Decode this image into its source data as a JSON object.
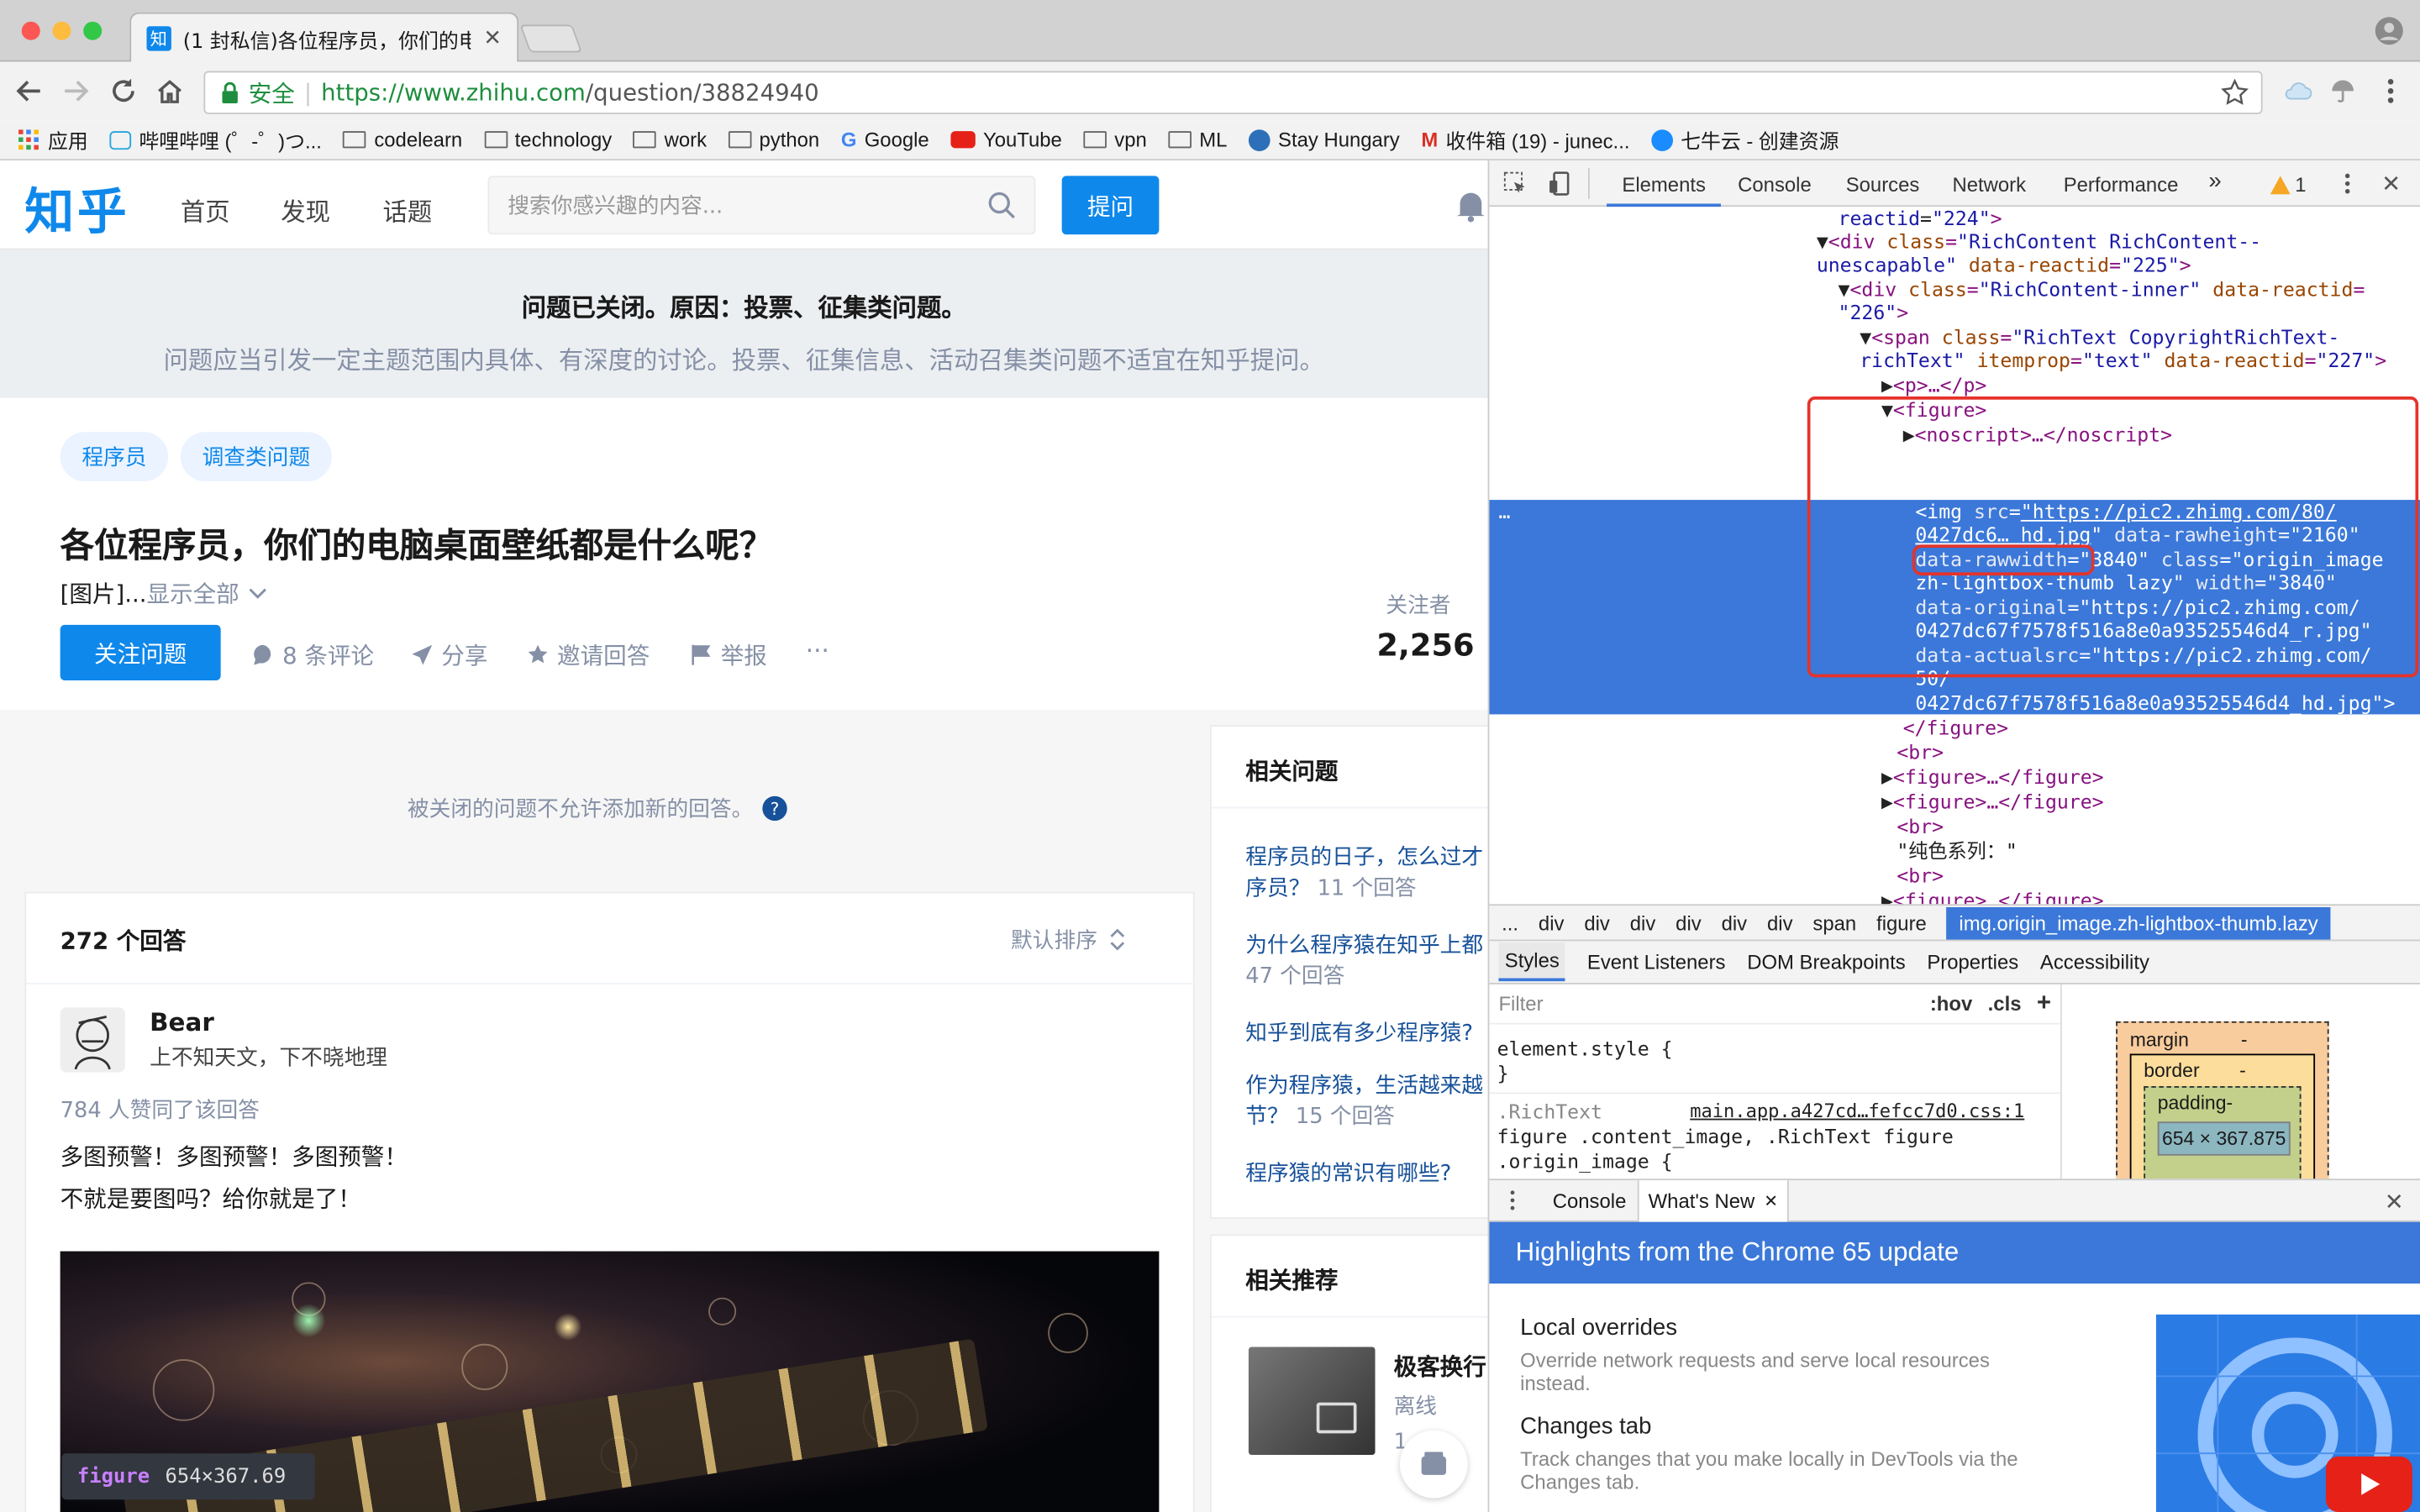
{
  "browser": {
    "tab_title": "(1 封私信)各位程序员，你们的电",
    "tab_favicon": "知",
    "secure_label": "安全",
    "url_origin": "https://www.zhihu.com",
    "url_path": "/question/38824940",
    "bookmarks": [
      "应用",
      "哔哩哔哩 (゜-゜)つ...",
      "codelearn",
      "technology",
      "work",
      "python",
      "Google",
      "YouTube",
      "vpn",
      "ML",
      "Stay Hungary",
      "收件箱 (19) - junec...",
      "七牛云 - 创建资源"
    ]
  },
  "zhihu": {
    "logo": "知乎",
    "nav": [
      "首页",
      "发现",
      "话题"
    ],
    "search_placeholder": "搜索你感兴趣的内容...",
    "ask_button": "提问",
    "notice_title": "问题已关闭。原因：投票、征集类问题。",
    "notice_desc": "问题应当引发一定主题范围内具体、有深度的讨论。投票、征集信息、活动召集类问题不适宜在知乎提问。",
    "tags": [
      "程序员",
      "调查类问题"
    ],
    "followers_label": "关注者",
    "followers_count": "2,256",
    "question_title": "各位程序员，你们的电脑桌面壁纸都是什么呢？",
    "excerpt": "[图片]...",
    "show_all": "显示全部",
    "follow_button": "关注问题",
    "actions": {
      "comments": "8 条评论",
      "share": "分享",
      "invite": "邀请回答",
      "report": "举报",
      "more": "···"
    },
    "closed_note": "被关闭的问题不允许添加新的回答。",
    "answer_count": "272 个回答",
    "sort_label": "默认排序",
    "author_name": "Bear",
    "author_bio": "上不知天文，下不晓地理",
    "likes": "784 人赞同了该回答",
    "answer_line1": "多图预警！多图预警！多图预警！",
    "answer_line2": "不就是要图吗？给你就是了！",
    "related_title": "相关问题",
    "related": [
      {
        "q1": "程序员的日子，怎么过才",
        "q2": "序员？",
        "count": "11 个回答"
      },
      {
        "q1": "为什么程序猿在知乎上都",
        "q2": "",
        "count": "47 个回答"
      },
      {
        "q1": "知乎到底有多少程序猿?",
        "q2": "",
        "count": ""
      },
      {
        "q1": "作为程序猿，生活越来越",
        "q2": "节？",
        "count": "15 个回答"
      },
      {
        "q1": "程序猿的常识有哪些?",
        "q2": "",
        "count": ""
      }
    ],
    "recommend_title": "相关推荐",
    "recommend_item_title": "极客换行",
    "recommend_item_sub": "离线",
    "recommend_item_extra": "1",
    "figure_tip_tag": "figure",
    "figure_tip_size": "654×367.69"
  },
  "devtools": {
    "tabs": [
      "Elements",
      "Console",
      "Sources",
      "Network",
      "Performance"
    ],
    "more_tabs": "»",
    "warning_count": "1",
    "breadcrumbs": [
      "...",
      "div",
      "div",
      "div",
      "div",
      "div",
      "div",
      "span",
      "figure"
    ],
    "breadcrumb_selected": "img.origin_image.zh-lightbox-thumb.lazy",
    "subtabs": [
      "Styles",
      "Event Listeners",
      "DOM Breakpoints",
      "Properties",
      "Accessibility"
    ],
    "filter_placeholder": "Filter",
    "hov": ":hov",
    "cls": ".cls",
    "style_line1": "element.style {",
    "style_line2": "}",
    "style_rule_selector": ".RichText",
    "style_source": "main.app.a427cd…fefcc7d0.css:1",
    "style_rule_line2": "figure .content_image, .RichText figure",
    "style_rule_line3": ".origin_image {",
    "box_margin": "margin",
    "box_border": "border",
    "box_padding": "padding-",
    "box_dash": "-",
    "box_size": "654 × 367.875",
    "drawer_tabs": [
      "Console",
      "What's New"
    ],
    "whats_new_title": "Highlights from the Chrome 65 update",
    "features": [
      {
        "title": "Local overrides",
        "desc1": "Override network requests and serve local resources",
        "desc2": "instead."
      },
      {
        "title": "Changes tab",
        "desc1": "Track changes that you make locally in DevTools via the",
        "desc2": "Changes tab."
      }
    ]
  }
}
